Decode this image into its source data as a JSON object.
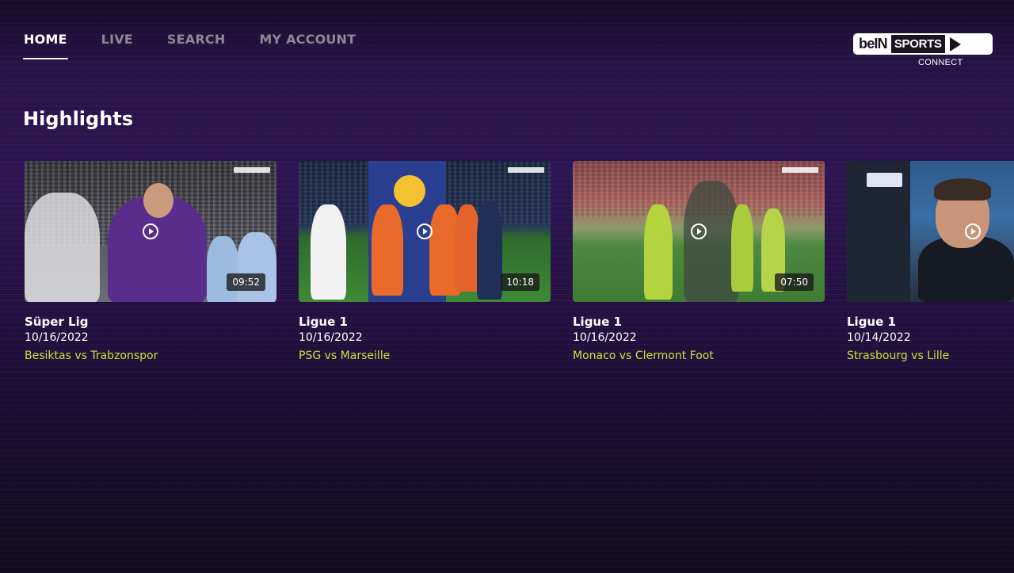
{
  "nav": {
    "items": [
      {
        "label": "HOME",
        "active": true
      },
      {
        "label": "LIVE",
        "active": false
      },
      {
        "label": "SEARCH",
        "active": false
      },
      {
        "label": "MY ACCOUNT",
        "active": false
      }
    ]
  },
  "logo": {
    "brand": "beIN",
    "sports": "SPORTS",
    "tagline": "CONNECT"
  },
  "section": {
    "title": "Highlights"
  },
  "cards": [
    {
      "league": "Süper Lig",
      "date": "10/16/2022",
      "match": "Besiktas vs Trabzonspor",
      "duration": "09:52",
      "play_icon": "play-circle-icon"
    },
    {
      "league": "Ligue 1",
      "date": "10/16/2022",
      "match": "PSG vs Marseille",
      "duration": "10:18",
      "play_icon": "play-circle-icon"
    },
    {
      "league": "Ligue 1",
      "date": "10/16/2022",
      "match": "Monaco vs Clermont Foot",
      "duration": "07:50",
      "play_icon": "play-circle-icon"
    },
    {
      "league": "Ligue 1",
      "date": "10/14/2022",
      "match": "Strasbourg vs Lille",
      "play_icon": "play-circle-icon"
    }
  ],
  "colors": {
    "accent_text": "#c6e33a",
    "nav_inactive": "#8d8796",
    "background": "#2b1450"
  }
}
